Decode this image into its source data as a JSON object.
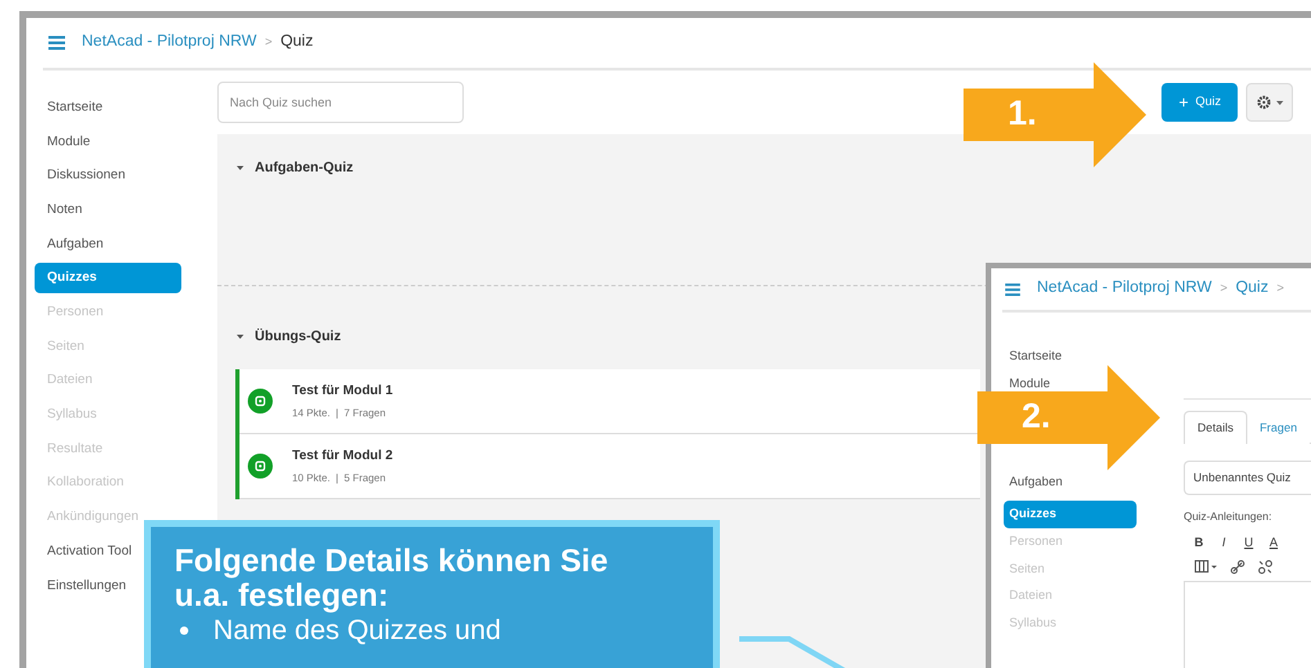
{
  "list_screen": {
    "breadcrumb": {
      "course": "NetAcad - Pilotproj NRW",
      "separator": ">",
      "page": "Quiz"
    },
    "sidebar": [
      {
        "label": "Startseite",
        "selected": false,
        "disabled": false
      },
      {
        "label": "Module",
        "selected": false,
        "disabled": false
      },
      {
        "label": "Diskussionen",
        "selected": false,
        "disabled": false
      },
      {
        "label": "Noten",
        "selected": false,
        "disabled": false
      },
      {
        "label": "Aufgaben",
        "selected": false,
        "disabled": false
      },
      {
        "label": "Quizzes",
        "selected": true,
        "disabled": false
      },
      {
        "label": "Personen",
        "selected": false,
        "disabled": true
      },
      {
        "label": "Seiten",
        "selected": false,
        "disabled": true
      },
      {
        "label": "Dateien",
        "selected": false,
        "disabled": true
      },
      {
        "label": "Syllabus",
        "selected": false,
        "disabled": true
      },
      {
        "label": "Resultate",
        "selected": false,
        "disabled": true
      },
      {
        "label": "Kollaboration",
        "selected": false,
        "disabled": true
      },
      {
        "label": "Ankündigungen",
        "selected": false,
        "disabled": true
      },
      {
        "label": "Activation Tool",
        "selected": false,
        "disabled": false
      },
      {
        "label": "Einstellungen",
        "selected": false,
        "disabled": false
      }
    ],
    "search": {
      "placeholder": "Nach Quiz suchen"
    },
    "add_button": {
      "icon": "+",
      "label": "Quiz"
    },
    "groups": [
      {
        "title": "Aufgaben-Quiz",
        "expanded": true
      },
      {
        "title": "Übungs-Quiz",
        "expanded": true,
        "quizzes": [
          {
            "title": "Test für Modul 1",
            "points": "14 Pkte.",
            "separator": "|",
            "questions": "7 Fragen"
          },
          {
            "title": "Test für Modul 2",
            "points": "10 Pkte.",
            "separator": "|",
            "questions": "5 Fragen"
          }
        ]
      }
    ]
  },
  "edit_screen": {
    "breadcrumb": {
      "course": "NetAcad - Pilotproj NRW",
      "separator": ">",
      "page": "Quiz",
      "separator_2": ">"
    },
    "sidebar": [
      {
        "label": "Startseite",
        "selected": false,
        "disabled": false
      },
      {
        "label": "Module",
        "selected": false,
        "disabled": false
      },
      {
        "label": "Aufgaben",
        "selected": false,
        "disabled": false
      },
      {
        "label": "Quizzes",
        "selected": true,
        "disabled": false
      },
      {
        "label": "Personen",
        "selected": false,
        "disabled": true
      },
      {
        "label": "Seiten",
        "selected": false,
        "disabled": true
      },
      {
        "label": "Dateien",
        "selected": false,
        "disabled": true
      },
      {
        "label": "Syllabus",
        "selected": false,
        "disabled": true
      }
    ],
    "tabs": [
      {
        "label": "Details",
        "selected": true
      },
      {
        "label": "Fragen",
        "selected": false
      }
    ],
    "title_field": {
      "value": "Unbenanntes Quiz"
    },
    "instructions_label": "Quiz-Anleitungen:",
    "format_buttons": [
      "B",
      "I",
      "U",
      "A"
    ]
  },
  "step_arrows": [
    {
      "label": "1."
    },
    {
      "label": "2."
    }
  ],
  "callout": {
    "title": "Folgende Details können Sie u.a. festlegen:",
    "bullets": [
      "Name des Quizzes und"
    ]
  }
}
